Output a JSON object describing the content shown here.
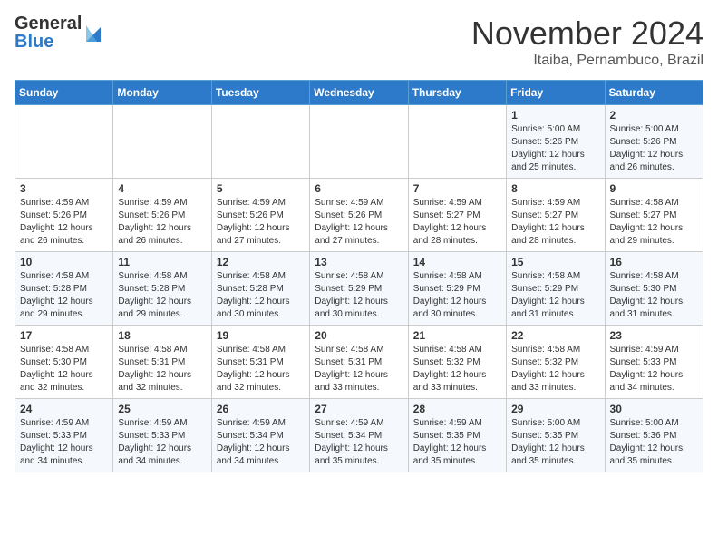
{
  "header": {
    "logo_general": "General",
    "logo_blue": "Blue",
    "month_title": "November 2024",
    "subtitle": "Itaiba, Pernambuco, Brazil"
  },
  "weekdays": [
    "Sunday",
    "Monday",
    "Tuesday",
    "Wednesday",
    "Thursday",
    "Friday",
    "Saturday"
  ],
  "weeks": [
    [
      {
        "day": "",
        "info": ""
      },
      {
        "day": "",
        "info": ""
      },
      {
        "day": "",
        "info": ""
      },
      {
        "day": "",
        "info": ""
      },
      {
        "day": "",
        "info": ""
      },
      {
        "day": "1",
        "info": "Sunrise: 5:00 AM\nSunset: 5:26 PM\nDaylight: 12 hours\nand 25 minutes."
      },
      {
        "day": "2",
        "info": "Sunrise: 5:00 AM\nSunset: 5:26 PM\nDaylight: 12 hours\nand 26 minutes."
      }
    ],
    [
      {
        "day": "3",
        "info": "Sunrise: 4:59 AM\nSunset: 5:26 PM\nDaylight: 12 hours\nand 26 minutes."
      },
      {
        "day": "4",
        "info": "Sunrise: 4:59 AM\nSunset: 5:26 PM\nDaylight: 12 hours\nand 26 minutes."
      },
      {
        "day": "5",
        "info": "Sunrise: 4:59 AM\nSunset: 5:26 PM\nDaylight: 12 hours\nand 27 minutes."
      },
      {
        "day": "6",
        "info": "Sunrise: 4:59 AM\nSunset: 5:26 PM\nDaylight: 12 hours\nand 27 minutes."
      },
      {
        "day": "7",
        "info": "Sunrise: 4:59 AM\nSunset: 5:27 PM\nDaylight: 12 hours\nand 28 minutes."
      },
      {
        "day": "8",
        "info": "Sunrise: 4:59 AM\nSunset: 5:27 PM\nDaylight: 12 hours\nand 28 minutes."
      },
      {
        "day": "9",
        "info": "Sunrise: 4:58 AM\nSunset: 5:27 PM\nDaylight: 12 hours\nand 29 minutes."
      }
    ],
    [
      {
        "day": "10",
        "info": "Sunrise: 4:58 AM\nSunset: 5:28 PM\nDaylight: 12 hours\nand 29 minutes."
      },
      {
        "day": "11",
        "info": "Sunrise: 4:58 AM\nSunset: 5:28 PM\nDaylight: 12 hours\nand 29 minutes."
      },
      {
        "day": "12",
        "info": "Sunrise: 4:58 AM\nSunset: 5:28 PM\nDaylight: 12 hours\nand 30 minutes."
      },
      {
        "day": "13",
        "info": "Sunrise: 4:58 AM\nSunset: 5:29 PM\nDaylight: 12 hours\nand 30 minutes."
      },
      {
        "day": "14",
        "info": "Sunrise: 4:58 AM\nSunset: 5:29 PM\nDaylight: 12 hours\nand 30 minutes."
      },
      {
        "day": "15",
        "info": "Sunrise: 4:58 AM\nSunset: 5:29 PM\nDaylight: 12 hours\nand 31 minutes."
      },
      {
        "day": "16",
        "info": "Sunrise: 4:58 AM\nSunset: 5:30 PM\nDaylight: 12 hours\nand 31 minutes."
      }
    ],
    [
      {
        "day": "17",
        "info": "Sunrise: 4:58 AM\nSunset: 5:30 PM\nDaylight: 12 hours\nand 32 minutes."
      },
      {
        "day": "18",
        "info": "Sunrise: 4:58 AM\nSunset: 5:31 PM\nDaylight: 12 hours\nand 32 minutes."
      },
      {
        "day": "19",
        "info": "Sunrise: 4:58 AM\nSunset: 5:31 PM\nDaylight: 12 hours\nand 32 minutes."
      },
      {
        "day": "20",
        "info": "Sunrise: 4:58 AM\nSunset: 5:31 PM\nDaylight: 12 hours\nand 33 minutes."
      },
      {
        "day": "21",
        "info": "Sunrise: 4:58 AM\nSunset: 5:32 PM\nDaylight: 12 hours\nand 33 minutes."
      },
      {
        "day": "22",
        "info": "Sunrise: 4:58 AM\nSunset: 5:32 PM\nDaylight: 12 hours\nand 33 minutes."
      },
      {
        "day": "23",
        "info": "Sunrise: 4:59 AM\nSunset: 5:33 PM\nDaylight: 12 hours\nand 34 minutes."
      }
    ],
    [
      {
        "day": "24",
        "info": "Sunrise: 4:59 AM\nSunset: 5:33 PM\nDaylight: 12 hours\nand 34 minutes."
      },
      {
        "day": "25",
        "info": "Sunrise: 4:59 AM\nSunset: 5:33 PM\nDaylight: 12 hours\nand 34 minutes."
      },
      {
        "day": "26",
        "info": "Sunrise: 4:59 AM\nSunset: 5:34 PM\nDaylight: 12 hours\nand 34 minutes."
      },
      {
        "day": "27",
        "info": "Sunrise: 4:59 AM\nSunset: 5:34 PM\nDaylight: 12 hours\nand 35 minutes."
      },
      {
        "day": "28",
        "info": "Sunrise: 4:59 AM\nSunset: 5:35 PM\nDaylight: 12 hours\nand 35 minutes."
      },
      {
        "day": "29",
        "info": "Sunrise: 5:00 AM\nSunset: 5:35 PM\nDaylight: 12 hours\nand 35 minutes."
      },
      {
        "day": "30",
        "info": "Sunrise: 5:00 AM\nSunset: 5:36 PM\nDaylight: 12 hours\nand 35 minutes."
      }
    ]
  ]
}
